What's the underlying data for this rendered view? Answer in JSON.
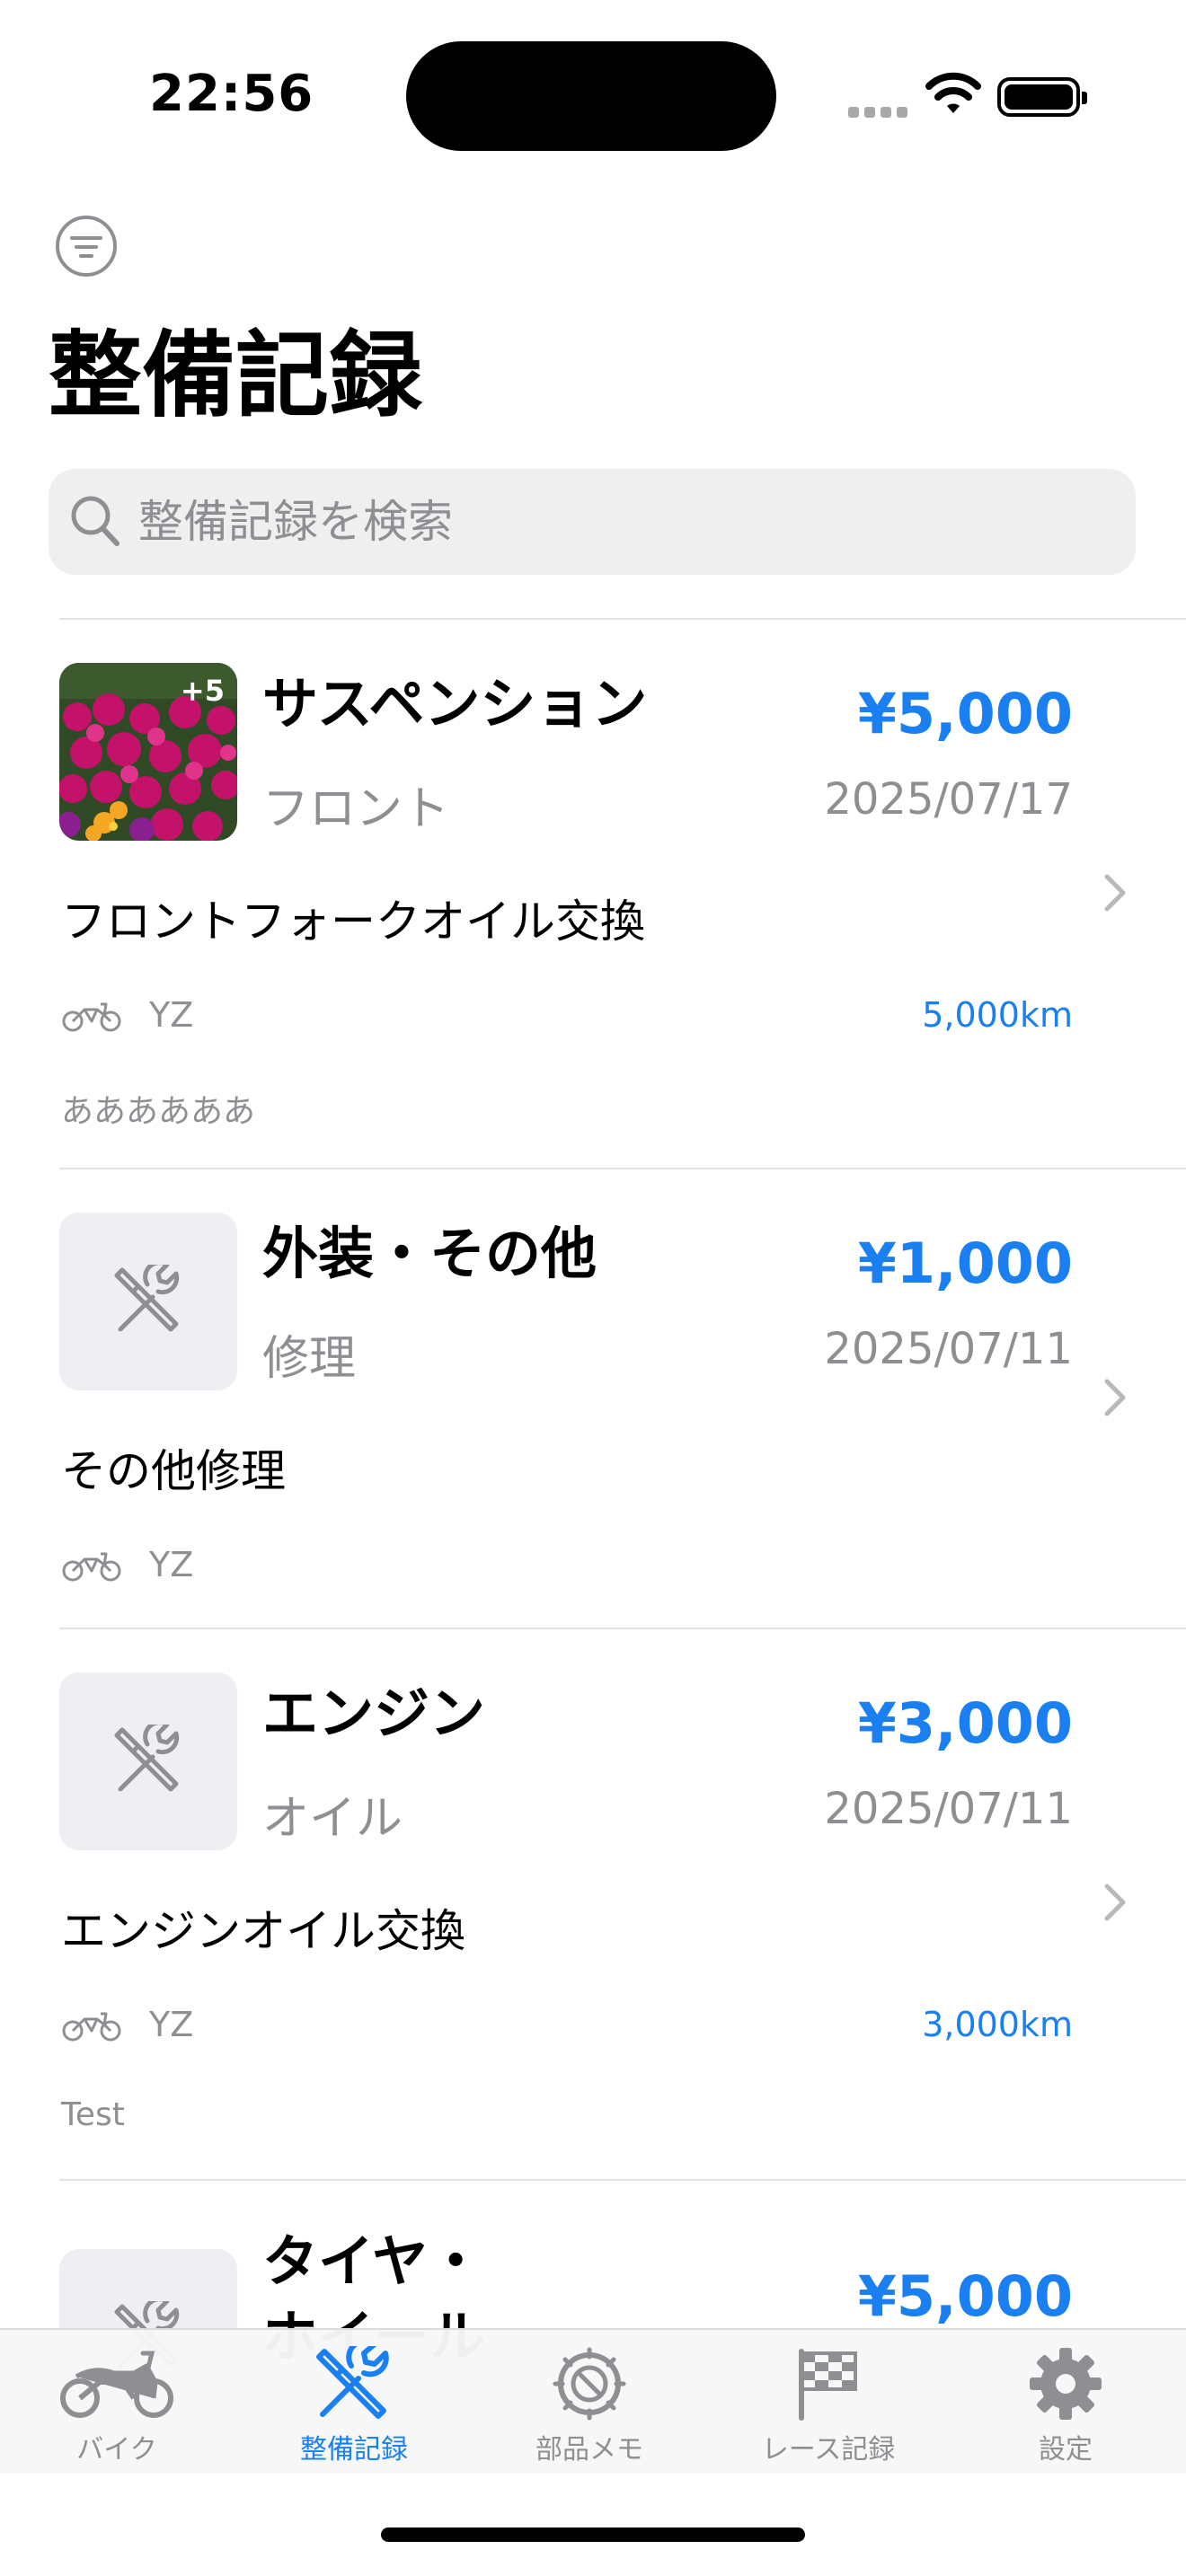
{
  "status_bar": {
    "time": "22:56"
  },
  "header": {
    "title": "整備記録"
  },
  "search": {
    "placeholder": "整備記録を検索"
  },
  "records": [
    {
      "category": "サスペンション",
      "subcategory": "フロント",
      "price": "¥5,000",
      "date": "2025/07/17",
      "description": "フロントフォークオイル交換",
      "bike": "YZ",
      "mileage": "5,000km",
      "memo": "ああああああ",
      "photo_badge": "+5"
    },
    {
      "category": "外装・その他",
      "subcategory": "修理",
      "price": "¥1,000",
      "date": "2025/07/11",
      "description": "その他修理",
      "bike": "YZ"
    },
    {
      "category": "エンジン",
      "subcategory": "オイル",
      "price": "¥3,000",
      "date": "2025/07/11",
      "description": "エンジンオイル交換",
      "bike": "YZ",
      "mileage": "3,000km",
      "memo": "Test"
    },
    {
      "category": "タイヤ・ホイール",
      "price": "¥5,000"
    }
  ],
  "tabs": [
    {
      "label": "バイク",
      "icon": "motorcycle-icon"
    },
    {
      "label": "整備記録",
      "icon": "wrench-screwdriver-icon",
      "active": true
    },
    {
      "label": "部品メモ",
      "icon": "gear-part-icon"
    },
    {
      "label": "レース記録",
      "icon": "checkered-flag-icon"
    },
    {
      "label": "設定",
      "icon": "gear-icon"
    }
  ],
  "colors": {
    "accent": "#1a7ff0",
    "secondary_text": "#8e8e93",
    "thumbnail_placeholder": "#efeff3"
  }
}
